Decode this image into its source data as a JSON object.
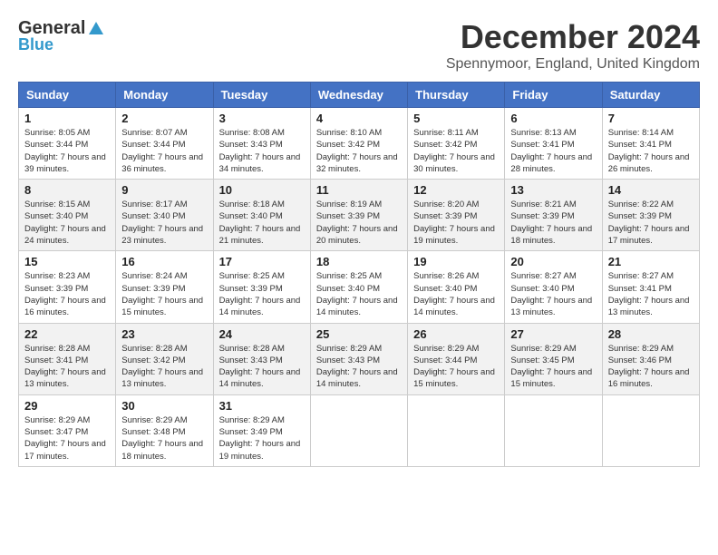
{
  "header": {
    "logo_general": "General",
    "logo_blue": "Blue",
    "month_title": "December 2024",
    "location": "Spennymoor, England, United Kingdom"
  },
  "weekdays": [
    "Sunday",
    "Monday",
    "Tuesday",
    "Wednesday",
    "Thursday",
    "Friday",
    "Saturday"
  ],
  "weeks": [
    [
      {
        "day": "1",
        "sunrise": "8:05 AM",
        "sunset": "3:44 PM",
        "daylight": "7 hours and 39 minutes."
      },
      {
        "day": "2",
        "sunrise": "8:07 AM",
        "sunset": "3:44 PM",
        "daylight": "7 hours and 36 minutes."
      },
      {
        "day": "3",
        "sunrise": "8:08 AM",
        "sunset": "3:43 PM",
        "daylight": "7 hours and 34 minutes."
      },
      {
        "day": "4",
        "sunrise": "8:10 AM",
        "sunset": "3:42 PM",
        "daylight": "7 hours and 32 minutes."
      },
      {
        "day": "5",
        "sunrise": "8:11 AM",
        "sunset": "3:42 PM",
        "daylight": "7 hours and 30 minutes."
      },
      {
        "day": "6",
        "sunrise": "8:13 AM",
        "sunset": "3:41 PM",
        "daylight": "7 hours and 28 minutes."
      },
      {
        "day": "7",
        "sunrise": "8:14 AM",
        "sunset": "3:41 PM",
        "daylight": "7 hours and 26 minutes."
      }
    ],
    [
      {
        "day": "8",
        "sunrise": "8:15 AM",
        "sunset": "3:40 PM",
        "daylight": "7 hours and 24 minutes."
      },
      {
        "day": "9",
        "sunrise": "8:17 AM",
        "sunset": "3:40 PM",
        "daylight": "7 hours and 23 minutes."
      },
      {
        "day": "10",
        "sunrise": "8:18 AM",
        "sunset": "3:40 PM",
        "daylight": "7 hours and 21 minutes."
      },
      {
        "day": "11",
        "sunrise": "8:19 AM",
        "sunset": "3:39 PM",
        "daylight": "7 hours and 20 minutes."
      },
      {
        "day": "12",
        "sunrise": "8:20 AM",
        "sunset": "3:39 PM",
        "daylight": "7 hours and 19 minutes."
      },
      {
        "day": "13",
        "sunrise": "8:21 AM",
        "sunset": "3:39 PM",
        "daylight": "7 hours and 18 minutes."
      },
      {
        "day": "14",
        "sunrise": "8:22 AM",
        "sunset": "3:39 PM",
        "daylight": "7 hours and 17 minutes."
      }
    ],
    [
      {
        "day": "15",
        "sunrise": "8:23 AM",
        "sunset": "3:39 PM",
        "daylight": "7 hours and 16 minutes."
      },
      {
        "day": "16",
        "sunrise": "8:24 AM",
        "sunset": "3:39 PM",
        "daylight": "7 hours and 15 minutes."
      },
      {
        "day": "17",
        "sunrise": "8:25 AM",
        "sunset": "3:39 PM",
        "daylight": "7 hours and 14 minutes."
      },
      {
        "day": "18",
        "sunrise": "8:25 AM",
        "sunset": "3:40 PM",
        "daylight": "7 hours and 14 minutes."
      },
      {
        "day": "19",
        "sunrise": "8:26 AM",
        "sunset": "3:40 PM",
        "daylight": "7 hours and 14 minutes."
      },
      {
        "day": "20",
        "sunrise": "8:27 AM",
        "sunset": "3:40 PM",
        "daylight": "7 hours and 13 minutes."
      },
      {
        "day": "21",
        "sunrise": "8:27 AM",
        "sunset": "3:41 PM",
        "daylight": "7 hours and 13 minutes."
      }
    ],
    [
      {
        "day": "22",
        "sunrise": "8:28 AM",
        "sunset": "3:41 PM",
        "daylight": "7 hours and 13 minutes."
      },
      {
        "day": "23",
        "sunrise": "8:28 AM",
        "sunset": "3:42 PM",
        "daylight": "7 hours and 13 minutes."
      },
      {
        "day": "24",
        "sunrise": "8:28 AM",
        "sunset": "3:43 PM",
        "daylight": "7 hours and 14 minutes."
      },
      {
        "day": "25",
        "sunrise": "8:29 AM",
        "sunset": "3:43 PM",
        "daylight": "7 hours and 14 minutes."
      },
      {
        "day": "26",
        "sunrise": "8:29 AM",
        "sunset": "3:44 PM",
        "daylight": "7 hours and 15 minutes."
      },
      {
        "day": "27",
        "sunrise": "8:29 AM",
        "sunset": "3:45 PM",
        "daylight": "7 hours and 15 minutes."
      },
      {
        "day": "28",
        "sunrise": "8:29 AM",
        "sunset": "3:46 PM",
        "daylight": "7 hours and 16 minutes."
      }
    ],
    [
      {
        "day": "29",
        "sunrise": "8:29 AM",
        "sunset": "3:47 PM",
        "daylight": "7 hours and 17 minutes."
      },
      {
        "day": "30",
        "sunrise": "8:29 AM",
        "sunset": "3:48 PM",
        "daylight": "7 hours and 18 minutes."
      },
      {
        "day": "31",
        "sunrise": "8:29 AM",
        "sunset": "3:49 PM",
        "daylight": "7 hours and 19 minutes."
      },
      null,
      null,
      null,
      null
    ]
  ]
}
